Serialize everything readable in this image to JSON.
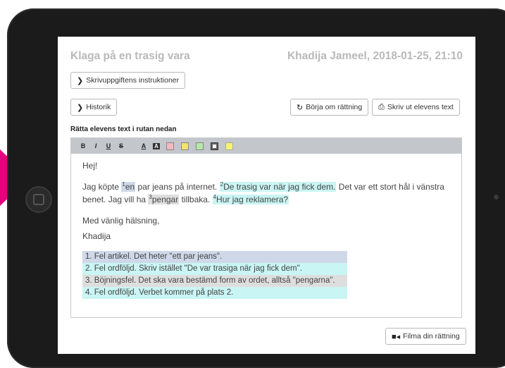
{
  "header": {
    "title": "Klaga på en trasig vara",
    "author_meta": "Khadija Jameel, 2018-01-25, 21:10"
  },
  "buttons": {
    "instructions": "Skrivuppgiftens instruktioner",
    "history": "Historik",
    "restart": "Börja om rättning",
    "print": "Skriv ut elevens text",
    "film": "Filma din rättning"
  },
  "editor": {
    "label": "Rätta elevens text i rutan nedan",
    "toolbar": [
      "B",
      "I",
      "U",
      "S",
      "A",
      "A"
    ],
    "swatch_colors": [
      "#f4b8c0",
      "#f5e26a",
      "#b6e8a7",
      "#6c6c6c",
      "#f7f36b"
    ],
    "greeting": "Hej!",
    "p1": {
      "t1": "Jag köpte ",
      "n1": "1",
      "m1": "en",
      "t2": " par jeans på internet. ",
      "n2": "2",
      "m2": "De trasig var när jag fick dem.",
      "t3": " Det var ett stort hål i vänstra benet. Jag vill ha ",
      "n3": "3",
      "m3": "pengar",
      "t4": " tillbaka. ",
      "n4": "4",
      "m4": "Hur jag reklamera?"
    },
    "closing": "Med vänlig hälsning,",
    "signature": "Khadija",
    "notes": [
      "1. Fel artikel. Det heter \"ett par jeans\".",
      "2. Fel ordföljd. Skriv istället \"De var trasiga när jag fick dem\".",
      "3. Böjningsfel. Det ska vara bestämd form av ordet, alltså \"pengarna\".",
      "4. Fel ordföljd. Verbet kommer på plats 2."
    ]
  },
  "colors": {
    "accent_pointer": "#e5007e",
    "note1": "#cfd8e8",
    "note2": "#c9f5f4",
    "note3": "#dedede"
  }
}
